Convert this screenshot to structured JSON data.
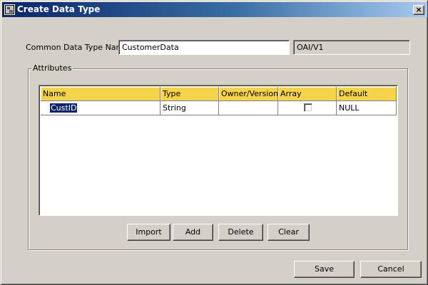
{
  "window": {
    "title": "Create Data Type",
    "close_glyph": "×"
  },
  "form": {
    "name_label": "Common Data Type Name:",
    "name_value": "CustomerData",
    "namespace_value": "OAI/V1"
  },
  "attributes": {
    "group_title": "Attributes",
    "columns": [
      "Name",
      "Type",
      "Owner/Version",
      "Array",
      "Default"
    ],
    "rows": [
      {
        "name": "CustID",
        "type": "String",
        "owner_version": "",
        "array": false,
        "default": "NULL"
      }
    ],
    "selected_row": 0,
    "header_color": "#f5d34a",
    "selection_color": "#0a246a"
  },
  "buttons": {
    "import": "Import",
    "add": "Add",
    "delete": "Delete",
    "clear": "Clear",
    "save": "Save",
    "cancel": "Cancel"
  },
  "icons": {
    "window_icon": "app-window-icon",
    "close": "close-icon",
    "array_checkbox": "checkbox-unchecked"
  }
}
